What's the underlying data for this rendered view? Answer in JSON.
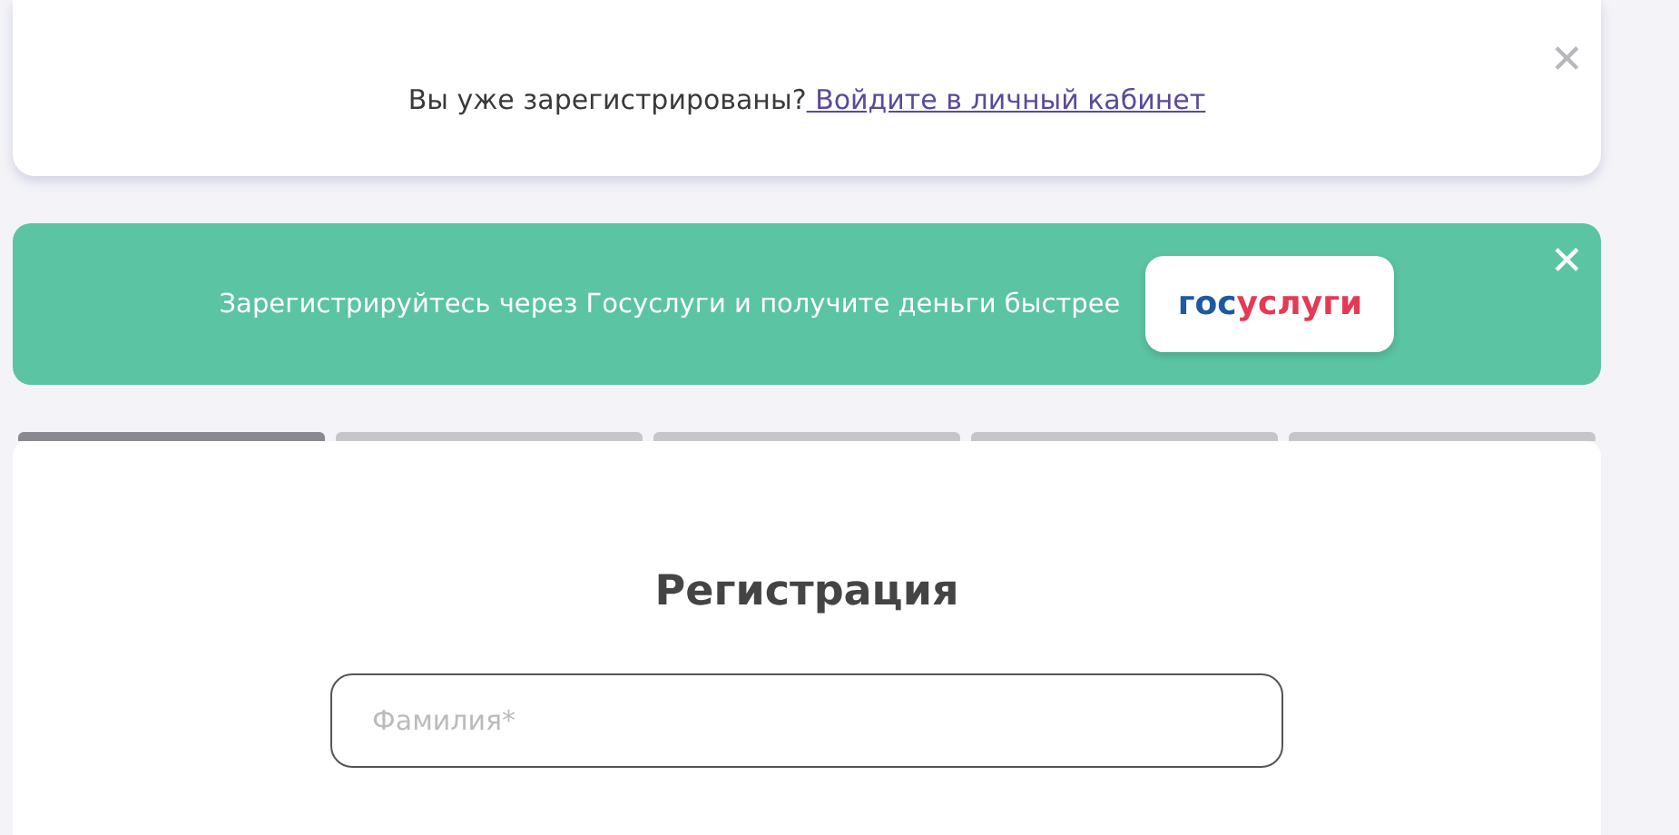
{
  "login_notice": {
    "text": "Вы уже зарегистрированы?",
    "link": " Войдите в личный кабинет",
    "close": "✕"
  },
  "gosuslugi_banner": {
    "text": "Зарегистрируйтесь через Госуслуги и получите деньги быстрее",
    "button_part_1": "гос",
    "button_part_2": "услуги",
    "close": "✕"
  },
  "steps": [
    {
      "completed": true
    },
    {
      "completed": false
    },
    {
      "completed": false
    },
    {
      "completed": false
    },
    {
      "completed": false
    }
  ],
  "form": {
    "title": "Регистрация",
    "fields": [
      {
        "placeholder": "Фамилия*"
      }
    ]
  }
}
